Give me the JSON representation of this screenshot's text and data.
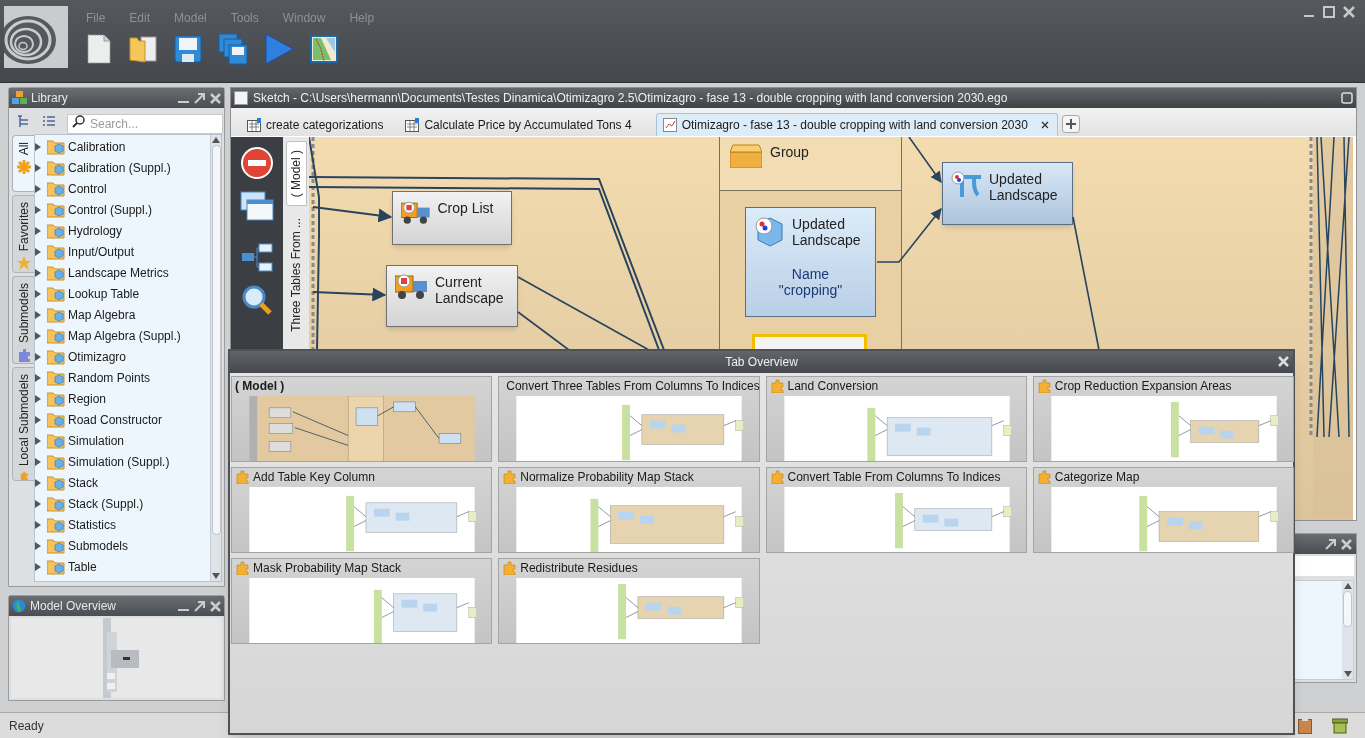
{
  "menu": [
    "File",
    "Edit",
    "Model",
    "Tools",
    "Window",
    "Help"
  ],
  "library": {
    "title": "Library",
    "search": {
      "placeholder": "Search..."
    },
    "side_tabs": [
      {
        "label": "All",
        "selected": true
      },
      {
        "label": "Favorites",
        "selected": false
      },
      {
        "label": "Submodels",
        "selected": false
      },
      {
        "label": "Local Submodels",
        "selected": false
      }
    ],
    "items": [
      "Calibration",
      "Calibration (Suppl.)",
      "Control",
      "Control (Suppl.)",
      "Hydrology",
      "Input/Output",
      "Landscape Metrics",
      "Lookup Table",
      "Map Algebra",
      "Map Algebra (Suppl.)",
      "Otimizagro",
      "Random Points",
      "Region",
      "Road Constructor",
      "Simulation",
      "Simulation (Suppl.)",
      "Stack",
      "Stack (Suppl.)",
      "Statistics",
      "Submodels",
      "Table"
    ]
  },
  "model_overview": {
    "title": "Model Overview"
  },
  "sketch": {
    "title": "Sketch - C:\\Users\\hermann\\Documents\\Testes Dinamica\\Otimizagro 2.5\\Otimizagro - fase 13 - double cropping with land conversion 2030.ego",
    "tabs": [
      {
        "label": "create categorizations",
        "selected": false
      },
      {
        "label": "Calculate Price by Accumulated Tons 4",
        "selected": false
      },
      {
        "label": "Otimizagro - fase 13 - double cropping with land conversion 2030",
        "selected": true
      }
    ],
    "side_tabs": [
      {
        "label": "( Model )",
        "selected": true
      },
      {
        "label": "Three Tables From ...",
        "selected": false
      }
    ],
    "group": {
      "label": "Group"
    },
    "nodes": [
      {
        "kind": "load",
        "label": "Crop List"
      },
      {
        "kind": "load",
        "label": "Current Landscape"
      },
      {
        "kind": "save",
        "label": "Updated Landscape",
        "name_label": "Name",
        "name_value": "\"cropping\""
      },
      {
        "kind": "boolean"
      },
      {
        "kind": "calc",
        "label": "Updated Landscape"
      }
    ]
  },
  "tab_overview": {
    "title": "Tab Overview",
    "cards": [
      {
        "title": "( Model )",
        "kind": "model"
      },
      {
        "title": "Convert Three Tables From Columns To Indices",
        "kind": "submodel"
      },
      {
        "title": "Land Conversion",
        "kind": "submodel"
      },
      {
        "title": "Crop Reduction Expansion Areas",
        "kind": "submodel"
      },
      {
        "title": "Add Table Key Column",
        "kind": "submodel"
      },
      {
        "title": "Normalize Probability Map Stack",
        "kind": "submodel"
      },
      {
        "title": "Convert Table From Columns To Indices",
        "kind": "submodel"
      },
      {
        "title": "Categorize Map",
        "kind": "submodel"
      },
      {
        "title": "Mask Probability Map Stack",
        "kind": "submodel"
      },
      {
        "title": "Redistribute Residues",
        "kind": "submodel"
      }
    ]
  },
  "status_bar": {
    "text": "Ready"
  }
}
